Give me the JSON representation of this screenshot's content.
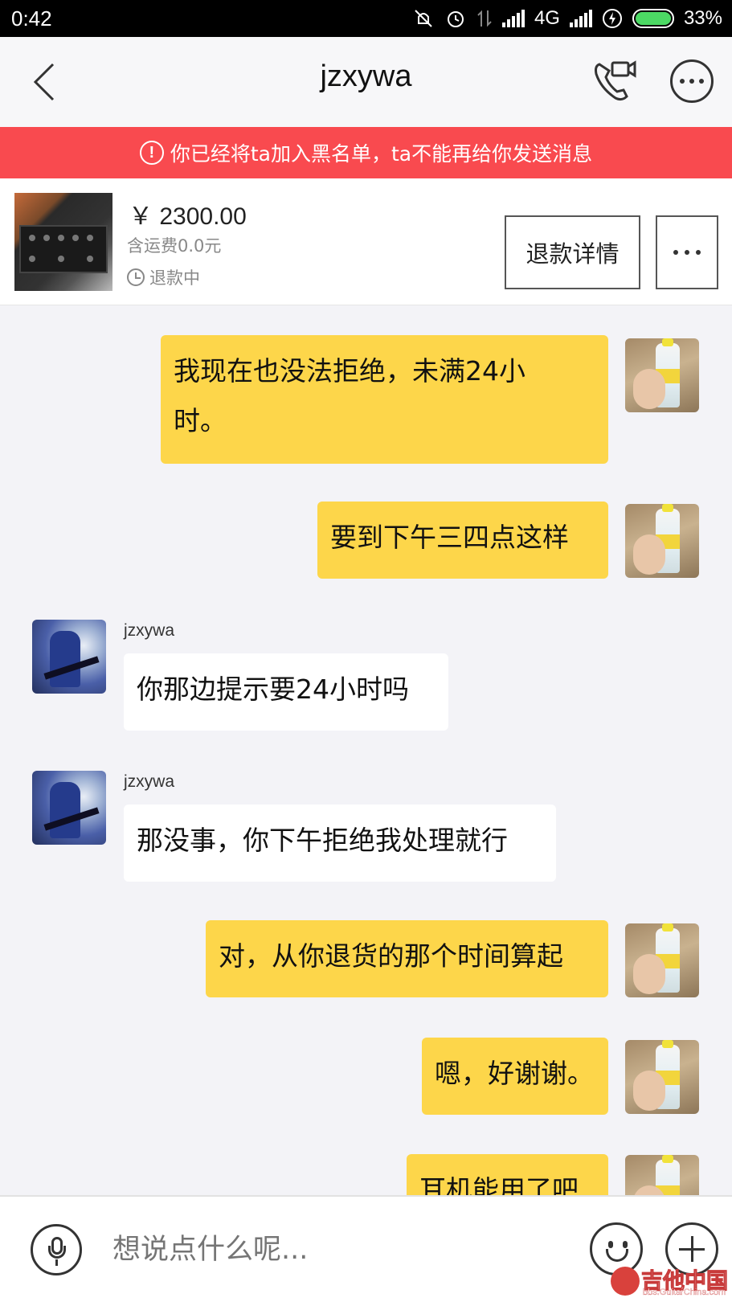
{
  "status_bar": {
    "time": "0:42",
    "network": "4G",
    "battery": "33%",
    "battery_level": 0.33
  },
  "header": {
    "title": "jzxywa"
  },
  "banner": {
    "text": "你已经将ta加入黑名单，ta不能再给你发送消息"
  },
  "product": {
    "price": "￥ 2300.00",
    "shipping": "含运费0.0元",
    "status": "退款中",
    "refund_button": "退款详情"
  },
  "messages": [
    {
      "from": "me",
      "lines": [
        "我现在也没法拒绝，未满24小",
        "时。"
      ]
    },
    {
      "from": "me",
      "text": "要到下午三四点这样"
    },
    {
      "from": "them",
      "sender": "jzxywa",
      "text": "你那边提示要24小时吗"
    },
    {
      "from": "them",
      "sender": "jzxywa",
      "text": "那没事，你下午拒绝我处理就行"
    },
    {
      "from": "me",
      "text": "对，从你退货的那个时间算起"
    },
    {
      "from": "me",
      "text": "嗯，好谢谢。"
    },
    {
      "from": "me",
      "text": "耳机能用了吧"
    }
  ],
  "input": {
    "placeholder": "想说点什么呢..."
  },
  "watermark": {
    "main": "吉他中国",
    "sub": "bbs.GuitarChina.com"
  },
  "colors": {
    "banner": "#f94a4f",
    "my_bubble": "#fdd64a",
    "their_bubble": "#ffffff",
    "chat_bg": "#f3f3f7"
  }
}
